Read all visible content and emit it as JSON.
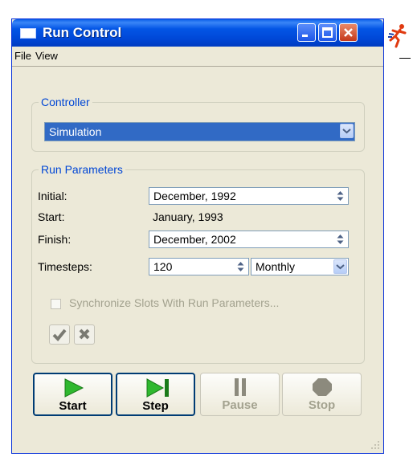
{
  "window": {
    "title": "Run Control"
  },
  "menu": {
    "file": "File",
    "view": "View"
  },
  "controller": {
    "group_label": "Controller",
    "selected": "Simulation"
  },
  "run_parameters": {
    "group_label": "Run Parameters",
    "initial_label": "Initial:",
    "initial_value": "December, 1992",
    "start_label": "Start:",
    "start_value": "January, 1993",
    "finish_label": "Finish:",
    "finish_value": "December, 2002",
    "timesteps_label": "Timesteps:",
    "timesteps_value": "120",
    "timestep_unit": "Monthly",
    "sync_label": "Synchronize Slots With Run Parameters..."
  },
  "controls": {
    "start": "Start",
    "step": "Step",
    "pause": "Pause",
    "stop": "Stop"
  },
  "colors": {
    "titlebar": "#0355e5",
    "selection": "#316ac5",
    "group_label": "#0046d5",
    "play_green": "#2fb82f",
    "disabled_text": "#a3a28f"
  },
  "icons": [
    "window-icon",
    "minimize-icon",
    "maximize-icon",
    "close-icon",
    "runner-icon",
    "chevron-down-icon",
    "spin-arrows-icon",
    "check-icon",
    "x-icon",
    "play-icon",
    "step-icon",
    "pause-icon",
    "stop-icon",
    "resize-grip-icon"
  ]
}
